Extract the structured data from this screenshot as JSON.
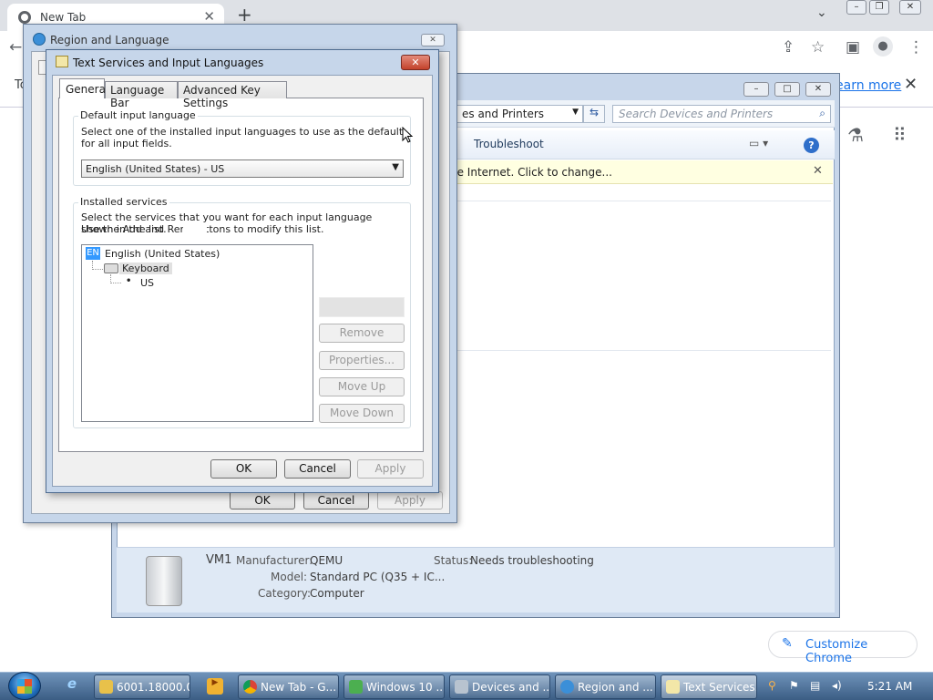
{
  "chrome": {
    "tab_title": "New Tab",
    "tab_close": "✕",
    "new_tab": "+",
    "tab_dropdown": "⌄",
    "learn_more": "earn more",
    "infobar_close": "✕",
    "infobar_partial": "To",
    "customize": "Customize Chrome",
    "icons": [
      "back-arrow-icon",
      "share-icon",
      "star-icon",
      "side-panel-icon",
      "profile-icon",
      "menu-icon",
      "labs-icon",
      "apps-grid-icon",
      "pencil-icon"
    ]
  },
  "devices": {
    "path": "es and Printers",
    "search_placeholder": "Search Devices and Printers",
    "troubleshoot": "Troubleshoot",
    "infobar": "ne Internet. Click to change...",
    "device_name": "VM1",
    "manufacturer_key": "Manufacturer:",
    "manufacturer_val": "QEMU",
    "model_key": "Model:",
    "model_val": "Standard PC (Q35 + IC...",
    "category_key": "Category:",
    "category_val": "Computer",
    "status_key": "Status:",
    "status_val": "Needs troubleshooting"
  },
  "region": {
    "title": "Region and Language",
    "ok": "OK",
    "cancel": "Cancel",
    "apply": "Apply"
  },
  "textservices": {
    "title": "Text Services and Input Languages",
    "tabs": [
      "General",
      "Language Bar",
      "Advanced Key Settings"
    ],
    "default_group": "Default input language",
    "default_desc": "Select one of the installed input languages to use as the default for all input fields.",
    "default_value": "English (United States) - US",
    "installed_group": "Installed services",
    "installed_desc1": "Select the services that you want for each input language shown in the list.",
    "installed_desc2": "Use the Add and Remov",
    "installed_desc3": "ttons to modify this list.",
    "lang_badge": "EN",
    "lang_node": "English (United States)",
    "kbd_node": "Keyboard",
    "us_node": "US",
    "btn_remove": "Remove",
    "btn_properties": "Properties...",
    "btn_moveup": "Move Up",
    "btn_movedown": "Move Down",
    "ok": "OK",
    "cancel": "Cancel",
    "apply": "Apply"
  },
  "taskbar": {
    "tasks": [
      "6001.18000.0...",
      "New Tab - G...",
      "Windows 10 ...",
      "Devices and ...",
      "Region and ...",
      "Text Services..."
    ],
    "clock": "5:21 AM"
  }
}
